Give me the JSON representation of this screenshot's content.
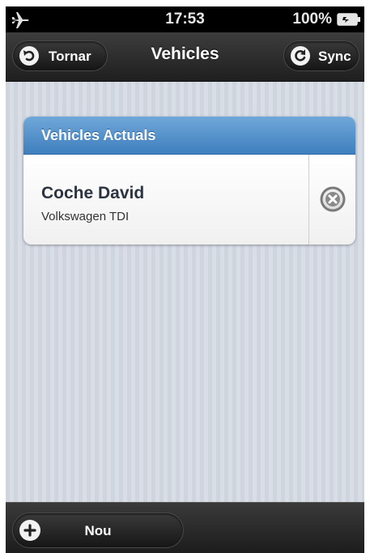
{
  "status_bar": {
    "time": "17:53",
    "battery_text": "100%",
    "icons": [
      "airplane-icon",
      "battery-icon"
    ]
  },
  "nav": {
    "title": "Vehicles",
    "back_label": "Tornar",
    "back_icon": "back-arrow-icon",
    "sync_label": "Sync",
    "sync_icon": "refresh-icon"
  },
  "panel": {
    "header": "Vehicles Actuals",
    "accent_color": "#4a8ac8",
    "items": [
      {
        "name": "Coche David",
        "model": "Volkswagen TDI",
        "action_icon": "delete-icon"
      }
    ]
  },
  "footer": {
    "new_label": "Nou",
    "new_icon": "plus-icon"
  }
}
